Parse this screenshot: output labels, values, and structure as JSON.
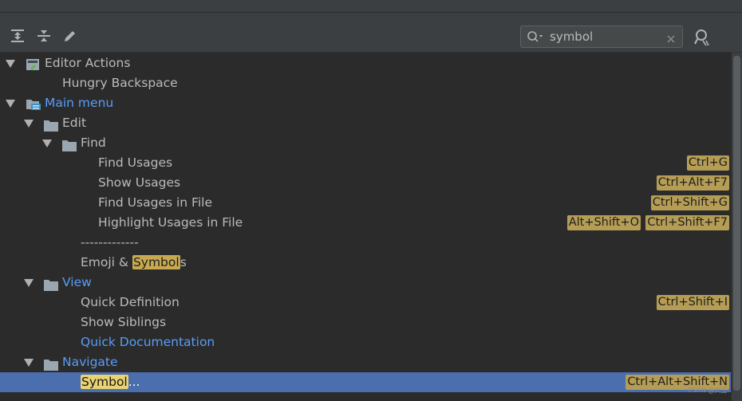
{
  "search": {
    "value": "symbol"
  },
  "tree": {
    "editor_actions": {
      "label": "Editor Actions"
    },
    "hungry_backspace": {
      "label": "Hungry Backspace"
    },
    "main_menu": {
      "label": "Main menu"
    },
    "edit": {
      "label": "Edit"
    },
    "find": {
      "label": "Find"
    },
    "find_usages": {
      "label": "Find Usages",
      "shortcut": "Ctrl+G"
    },
    "show_usages": {
      "label": "Show Usages",
      "shortcut": "Ctrl+Alt+F7"
    },
    "find_usages_in_file": {
      "label": "Find Usages in File",
      "shortcut": "Ctrl+Shift+G"
    },
    "highlight_usages": {
      "label": "Highlight Usages in File",
      "shortcut1": "Alt+Shift+O",
      "shortcut2": "Ctrl+Shift+F7"
    },
    "separator": {
      "label": "-------------"
    },
    "emoji_symbols": {
      "pre": "Emoji & ",
      "match": "Symbol",
      "post": "s"
    },
    "view": {
      "label": "View"
    },
    "quick_definition": {
      "label": "Quick Definition",
      "shortcut": "Ctrl+Shift+I"
    },
    "show_siblings": {
      "label": "Show Siblings"
    },
    "quick_documentation": {
      "label": "Quick Documentation"
    },
    "navigate": {
      "label": "Navigate"
    },
    "symbol": {
      "match": "Symbol",
      "post": "...",
      "shortcut": "Ctrl+Alt+Shift+N"
    }
  },
  "watermark": "CSDN @大卫"
}
